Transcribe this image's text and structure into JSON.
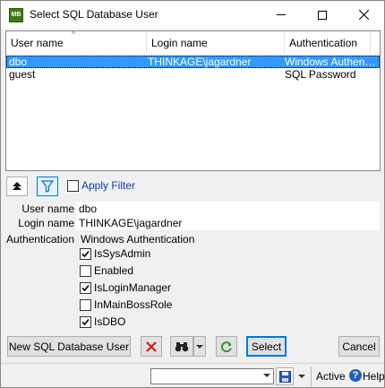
{
  "window": {
    "title": "Select SQL Database User",
    "app_icon_text": "MB"
  },
  "list": {
    "columns": [
      "User name",
      "Login name",
      "Authentication"
    ],
    "rows": [
      {
        "user": "dbo",
        "login": "THINKAGE\\jagardner",
        "auth": "Windows Authentic...",
        "selected": true
      },
      {
        "user": "guest",
        "login": "",
        "auth": "SQL Password",
        "selected": false
      }
    ]
  },
  "filter": {
    "apply_label": "Apply Filter",
    "apply_checked": false
  },
  "details": {
    "user_name_label": "User name",
    "user_name_value": "dbo",
    "login_name_label": "Login name",
    "login_name_value": "THINKAGE\\jagardner",
    "authentication_label": "Authentication",
    "authentication_value": "Windows Authentication",
    "checkboxes": [
      {
        "label": "IsSysAdmin",
        "checked": true
      },
      {
        "label": "Enabled",
        "checked": false
      },
      {
        "label": "IsLoginManager",
        "checked": true
      },
      {
        "label": "InMainBossRole",
        "checked": false
      },
      {
        "label": "IsDBO",
        "checked": true
      }
    ]
  },
  "buttons": {
    "new_user": "New SQL Database User",
    "select": "Select",
    "cancel": "Cancel"
  },
  "statusbar": {
    "combo_value": "",
    "active_label": "Active",
    "help_label": "Help"
  },
  "colors": {
    "selection": "#3399ff",
    "accent": "#0078d7",
    "delete_red": "#d11a1a",
    "refresh_green": "#2e9a2e"
  }
}
